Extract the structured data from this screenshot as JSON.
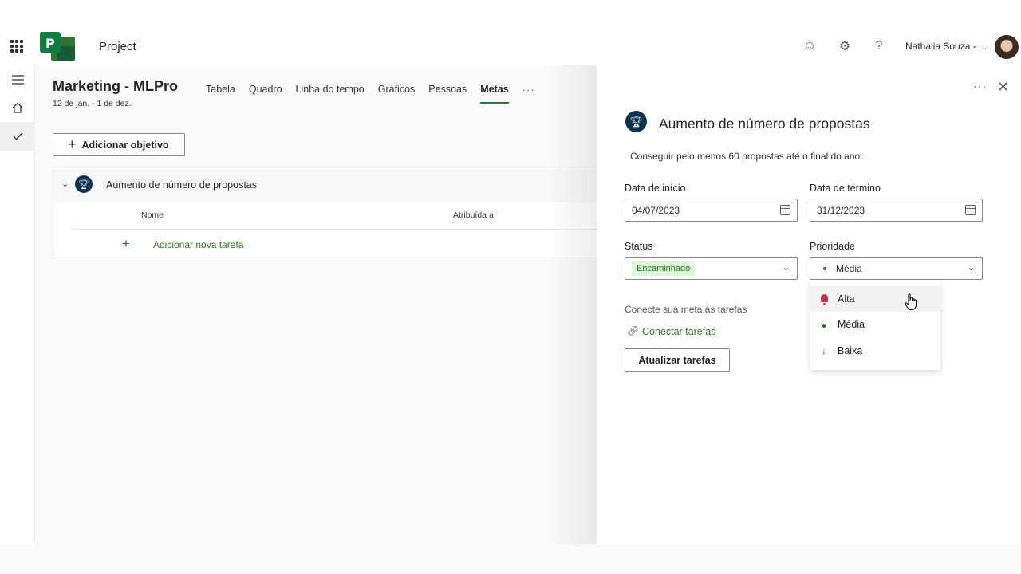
{
  "app": {
    "title": "Project",
    "user_name": "Nathalia Souza - ..."
  },
  "plan": {
    "title": "Marketing - MLPro",
    "dates": "12 de jan. - 1 de dez.",
    "tabs": [
      "Tabela",
      "Quadro",
      "Linha do tempo",
      "Gráficos",
      "Pessoas",
      "Metas"
    ],
    "active_tab": "Metas",
    "more_label": "···"
  },
  "goals": {
    "add_goal_label": "Adicionar objetivo",
    "goal_name": "Aumento de número de propostas",
    "col_name": "Nome",
    "col_assigned": "Atribuída a",
    "add_task_label": "Adicionar nova tarefa"
  },
  "panel": {
    "title": "Aumento de número de propostas",
    "description": "Conseguir pelo menos 60 propostas até o final do ano.",
    "start_label": "Data de início",
    "start_value": "04/07/2023",
    "end_label": "Data de término",
    "end_value": "31/12/2023",
    "status_label": "Status",
    "status_value": "Encaminhado",
    "priority_label": "Prioridade",
    "priority_value": "Média",
    "connect_label": "Conecte sua meta às tarefas",
    "connect_link": "Conectar tarefas",
    "update_button": "Atualizar tarefas"
  },
  "priority_menu": {
    "items": [
      "Alta",
      "Média",
      "Baixa"
    ],
    "hovered": "Alta"
  },
  "colors": {
    "accent_green": "#31752f",
    "goal_icon_navy": "#0f3251",
    "high_priority_red": "#c4314b",
    "status_badge_bg": "#dff6dd"
  }
}
